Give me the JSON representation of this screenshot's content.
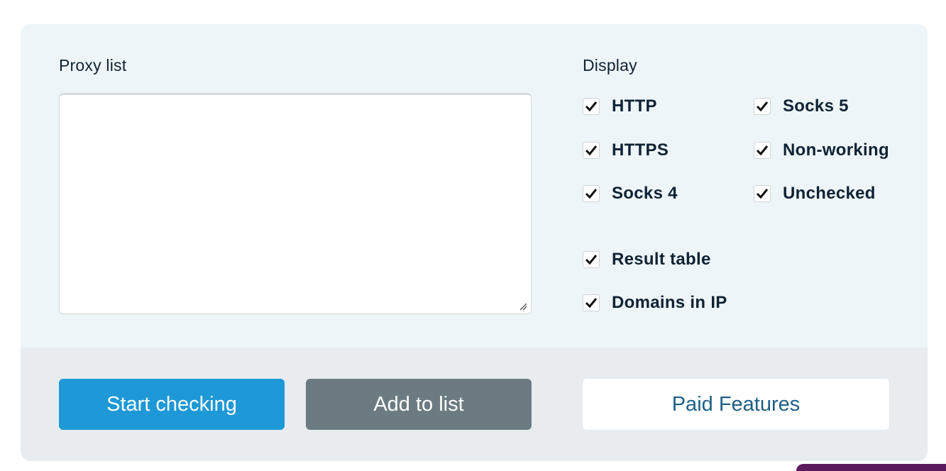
{
  "proxy_list": {
    "label": "Proxy list",
    "value": "",
    "placeholder": ""
  },
  "display": {
    "label": "Display",
    "protocols": [
      {
        "label": "HTTP",
        "checked": true
      },
      {
        "label": "HTTPS",
        "checked": true
      },
      {
        "label": "Socks 4",
        "checked": true
      },
      {
        "label": "Socks 5",
        "checked": true
      },
      {
        "label": "Non-working",
        "checked": true
      },
      {
        "label": "Unchecked",
        "checked": true
      }
    ],
    "options": [
      {
        "label": "Result table",
        "checked": true
      },
      {
        "label": "Domains in IP",
        "checked": true
      }
    ]
  },
  "actions": {
    "start_label": "Start checking",
    "add_label": "Add to list",
    "paid_label": "Paid Features"
  },
  "colors": {
    "panel_bg": "#eef5f9",
    "footer_bg": "#e8ecef",
    "primary": "#1e98d6",
    "secondary": "#6b7b81",
    "paid_text": "#1e5f86",
    "text": "#0f2233",
    "accent_purple": "#5c1a5e"
  }
}
